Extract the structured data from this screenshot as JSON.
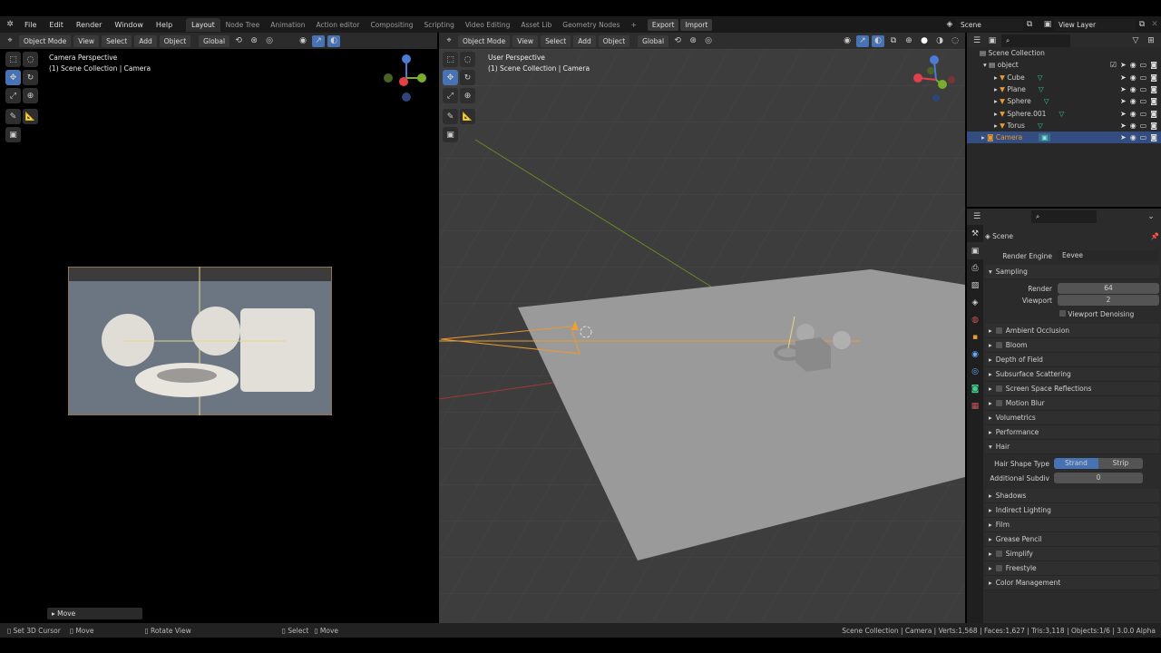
{
  "menu": [
    "File",
    "Edit",
    "Render",
    "Window",
    "Help"
  ],
  "workspaces": [
    "Layout",
    "Node Tree",
    "Animation",
    "Action editor",
    "Compositing",
    "Scripting",
    "Video Editing",
    "Asset Lib",
    "Geometry Nodes"
  ],
  "export_label": "Export",
  "import_label": "Import",
  "scene_name": "Scene",
  "view_layer": "View Layer",
  "header": {
    "mode": "Object Mode",
    "view": "View",
    "select": "Select",
    "add": "Add",
    "object": "Object",
    "orientation": "Global"
  },
  "left_viewport": {
    "title": "Camera Perspective",
    "subtitle": "(1) Scene Collection | Camera",
    "last_op": "Move"
  },
  "right_viewport": {
    "title": "User Perspective",
    "subtitle": "(1) Scene Collection | Camera"
  },
  "outliner": {
    "root": "Scene Collection",
    "collection": "object",
    "items": [
      "Cube",
      "Plane",
      "Sphere",
      "Sphere.001",
      "Torus"
    ],
    "camera": "Camera"
  },
  "properties": {
    "context": "Scene",
    "render_engine_label": "Render Engine",
    "render_engine": "Eevee",
    "sampling": {
      "title": "Sampling",
      "render_label": "Render",
      "render": "64",
      "viewport_label": "Viewport",
      "viewport": "2",
      "denoise": "Viewport Denoising"
    },
    "panels_a": [
      {
        "label": "Ambient Occlusion",
        "check": true
      },
      {
        "label": "Bloom",
        "check": true
      },
      {
        "label": "Depth of Field",
        "check": false
      },
      {
        "label": "Subsurface Scattering",
        "check": false
      },
      {
        "label": "Screen Space Reflections",
        "check": true
      },
      {
        "label": "Motion Blur",
        "check": true
      },
      {
        "label": "Volumetrics",
        "check": false
      },
      {
        "label": "Performance",
        "check": false
      }
    ],
    "hair": {
      "title": "Hair",
      "shape_label": "Hair Shape Type",
      "strand": "Strand",
      "strip": "Strip",
      "subdiv_label": "Additional Subdiv",
      "subdiv": "0"
    },
    "panels_b": [
      {
        "label": "Shadows",
        "check": false
      },
      {
        "label": "Indirect Lighting",
        "check": false
      },
      {
        "label": "Film",
        "check": false
      },
      {
        "label": "Grease Pencil",
        "check": false
      },
      {
        "label": "Simplify",
        "check": true
      },
      {
        "label": "Freestyle",
        "check": true
      },
      {
        "label": "Color Management",
        "check": false
      }
    ]
  },
  "status": {
    "left_click": "Set 3D Cursor",
    "left_drag": "Move",
    "middle": "Rotate View",
    "right_select": "Select",
    "right_move": "Move",
    "stats": "Scene Collection | Camera | Verts:1,568 | Faces:1,627 | Tris:3,118 | Objects:1/6 | 3.0.0 Alpha"
  },
  "colors": {
    "accent": "#4772b3",
    "selection": "#334d80",
    "camera_orange": "#f0a030"
  }
}
